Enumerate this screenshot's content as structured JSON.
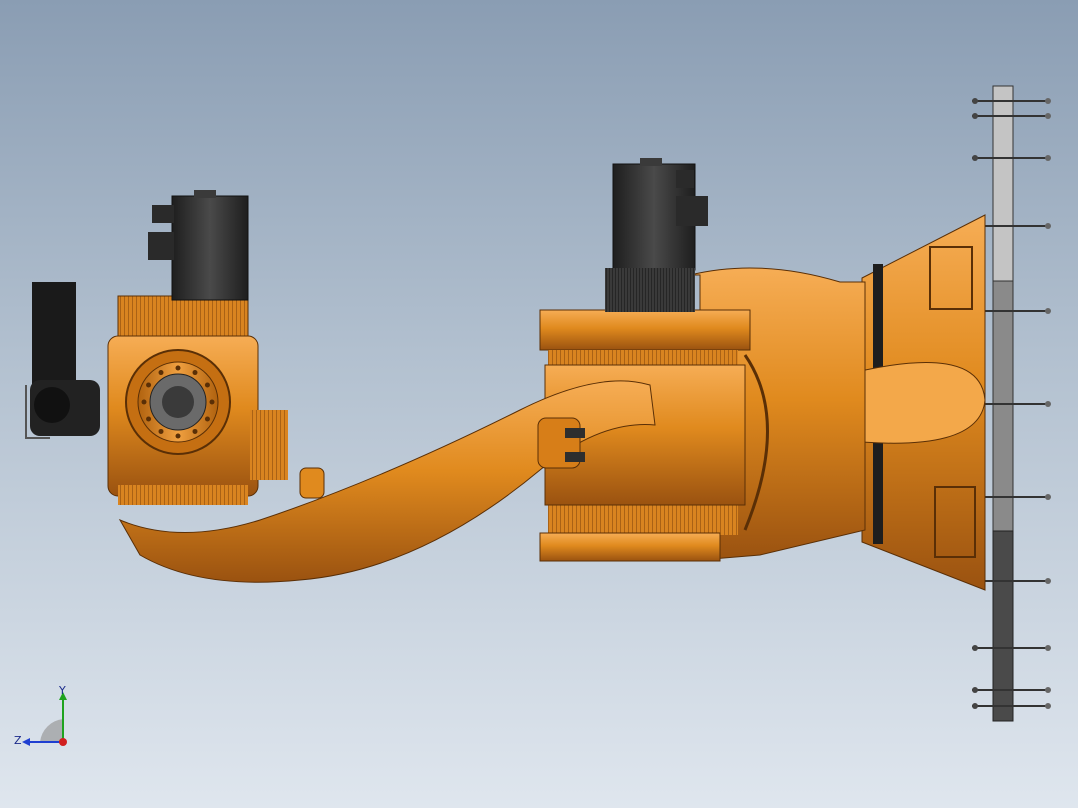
{
  "viewport": {
    "model": "robot-arm-side-view",
    "colors": {
      "background_top": "#8a9db3",
      "background_bottom": "#dfe6ee",
      "body_orange": "#e08a1e",
      "body_shadow": "#a85a10",
      "motor_black": "#2e2e2e",
      "plate_gray": "#b8b8b8",
      "plate_dark": "#555555"
    }
  },
  "triad": {
    "y_label": "Y",
    "z_label": "Z",
    "x_axis_color": "#d11f1f",
    "y_axis_color": "#1fa31f",
    "z_axis_color": "#1f3fd1"
  }
}
